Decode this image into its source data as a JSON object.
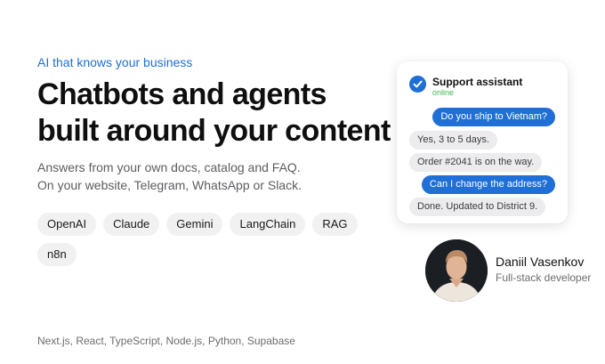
{
  "hero": {
    "eyebrow": "AI that knows your business",
    "headline_line1": "Chatbots and agents",
    "headline_line2": "built around your content",
    "sub_line1": "Answers from your own docs, catalog and FAQ.",
    "sub_line2": "On your website, Telegram, WhatsApp or Slack."
  },
  "tags": [
    "OpenAI",
    "Claude",
    "Gemini",
    "LangChain",
    "RAG",
    "n8n"
  ],
  "stack": "Next.js, React, TypeScript, Node.js, Python, Supabase",
  "chat": {
    "title": "Support assistant",
    "status": "online",
    "messages": [
      {
        "from": "user",
        "text": "Do you ship to Vietnam?"
      },
      {
        "from": "bot",
        "text": "Yes, 3 to 5 days."
      },
      {
        "from": "bot",
        "text": "Order #2041 is on the way."
      },
      {
        "from": "user",
        "text": "Can I change the address?"
      },
      {
        "from": "bot",
        "text": "Done. Updated to District 9."
      }
    ]
  },
  "person": {
    "name": "Daniil Vasenkov",
    "role": "Full-stack developer"
  },
  "colors": {
    "accent": "#1f6fd6",
    "online": "#3fb950",
    "chip_bg": "#f1f1f2",
    "bot_bubble": "#ececee"
  },
  "icons": {
    "verified": "check-circle-icon"
  }
}
